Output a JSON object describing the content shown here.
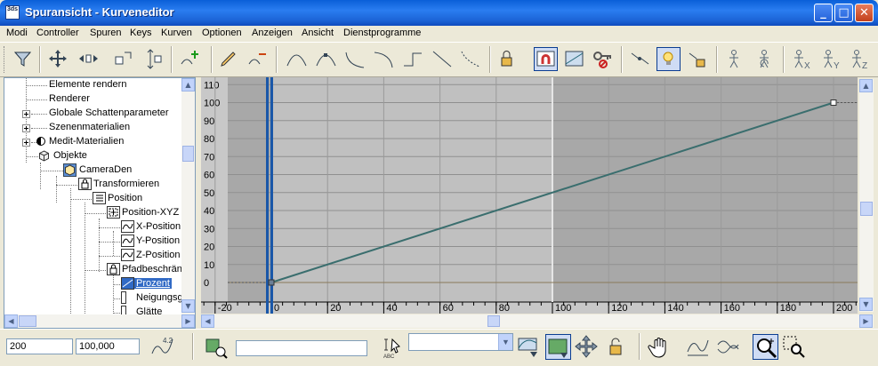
{
  "window": {
    "title": "Spuransicht - Kurveneditor",
    "app_icon_text": "3ds"
  },
  "menu": [
    "Modi",
    "Controller",
    "Spuren",
    "Keys",
    "Kurven",
    "Optionen",
    "Anzeigen",
    "Ansicht",
    "Dienstprogramme"
  ],
  "tree": {
    "items": [
      {
        "label": "Elemente rendern"
      },
      {
        "label": "Renderer"
      },
      {
        "label": "Globale Schattenparameter"
      },
      {
        "label": "Szenenmaterialien"
      },
      {
        "label": "Medit-Materialien"
      },
      {
        "label": "Objekte"
      },
      {
        "label": "CameraDen"
      },
      {
        "label": "Transformieren"
      },
      {
        "label": "Position"
      },
      {
        "label": "Position-XYZ"
      },
      {
        "label": "X-Position"
      },
      {
        "label": "Y-Position"
      },
      {
        "label": "Z-Position"
      },
      {
        "label": "Pfadbeschränkung"
      },
      {
        "label": "Prozent"
      },
      {
        "label": "Neigungsgrad"
      },
      {
        "label": "Glätte"
      }
    ]
  },
  "graph": {
    "y_ticks": [
      "110",
      "100",
      "90",
      "80",
      "70",
      "60",
      "50",
      "40",
      "30",
      "20",
      "10",
      "0"
    ],
    "x_ticks": [
      "-20",
      "0",
      "20",
      "40",
      "60",
      "80",
      "100",
      "120",
      "140",
      "160",
      "180",
      "200"
    ],
    "curve_color": "#3a6e6e",
    "curve_keys": [
      {
        "frame": 0,
        "value": 0
      },
      {
        "frame": 200,
        "value": 100
      }
    ],
    "current_frame": 0
  },
  "bottom": {
    "frame_value": "200",
    "key_value": "100,000",
    "search_value": ""
  },
  "colors": {
    "active_range": "#c0c0c0",
    "inactive_range": "#a8a8a8",
    "title_blue": "#2a7df0"
  }
}
